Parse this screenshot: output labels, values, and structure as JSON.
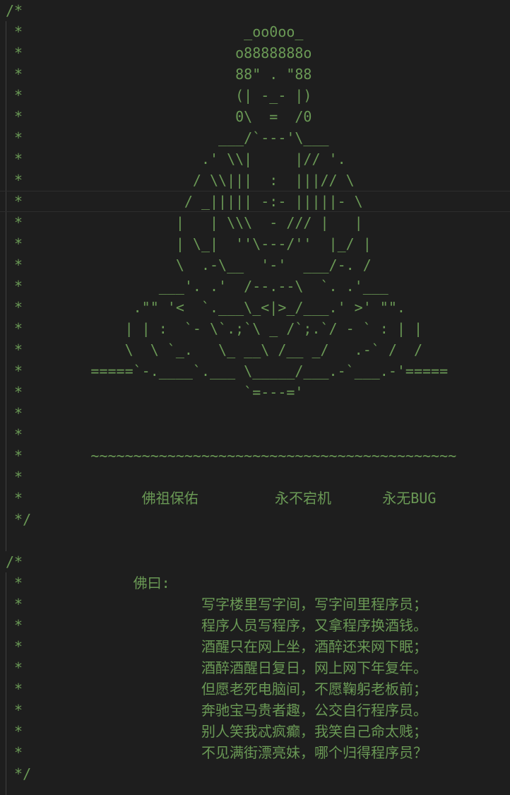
{
  "editor": {
    "comment_color": "#6a9955",
    "background": "#1e1e1e",
    "lines": [
      "/*",
      " *                          _oo0oo_",
      " *                         o8888888o",
      " *                         88\" . \"88",
      " *                         (| -_- |)",
      " *                         0\\  =  /0",
      " *                       ___/`---'\\___",
      " *                     .' \\\\|     |// '.",
      " *                    / \\\\|||  :  |||// \\",
      " *                   / _||||| -:- |||||- \\",
      " *                  |   | \\\\\\  - /// |   |",
      " *                  | \\_|  ''\\---/''  |_/ |",
      " *                  \\  .-\\__  '-'  ___/-. /",
      " *                ___'. .'  /--.--\\  `. .'___",
      " *             .\"\" '<  `.___\\_<|>_/___.' >' \"\".",
      " *            | | :  `- \\`.;`\\ _ /`;.`/ - ` : | |",
      " *            \\  \\ `_.   \\_ __\\ /__ _/   .-` /  /",
      " *        =====`-.____`.___ \\_____/___.-`___.-'=====",
      " *                          `=---='",
      " *",
      " *",
      " *        ~~~~~~~~~~~~~~~~~~~~~~~~~~~~~~~~~~~~~~~~~~~",
      " *",
      " *              佛祖保佑         永不宕机      永无BUG",
      " */",
      "",
      "/*",
      " *             佛曰:",
      " *                     写字楼里写字间，写字间里程序员；",
      " *                     程序人员写程序，又拿程序换酒钱。",
      " *                     酒醒只在网上坐，酒醉还来网下眠；",
      " *                     酒醉酒醒日复日，网上网下年复年。",
      " *                     但愿老死电脑间，不愿鞠躬老板前；",
      " *                     奔驰宝马贵者趣，公交自行程序员。",
      " *                     别人笑我忒疯癫，我笑自己命太贱；",
      " *                     不见满街漂亮妹，哪个归得程序员？",
      " */"
    ]
  }
}
